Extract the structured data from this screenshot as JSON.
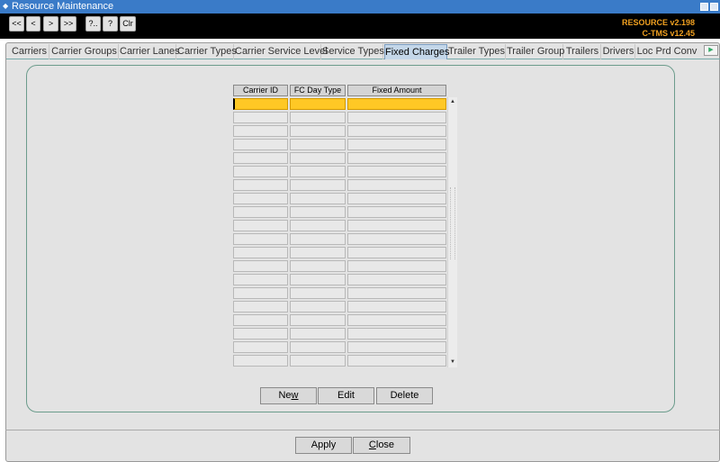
{
  "window": {
    "title": "Resource Maintenance",
    "app_icon": "java-icon",
    "min_icon": "minimize-icon",
    "max_icon": "maximize-icon"
  },
  "toolbar": {
    "first": "<<",
    "prev": "<",
    "next": ">",
    "last": ">>",
    "query": "?..",
    "execute": "?",
    "clear": "Clr"
  },
  "version": {
    "resource": "RESOURCE v2.198",
    "ctms": "C-TMS v12.45"
  },
  "tabs": [
    {
      "label": "Carriers"
    },
    {
      "label": "Carrier Groups"
    },
    {
      "label": "Carrier Lanes"
    },
    {
      "label": "Carrier Types"
    },
    {
      "label": "Carrier Service Level"
    },
    {
      "label": "Service Types"
    },
    {
      "label": "Fixed Charges",
      "active": true
    },
    {
      "label": "Trailer Types"
    },
    {
      "label": "Trailer Group"
    },
    {
      "label": "Trailers"
    },
    {
      "label": "Drivers"
    },
    {
      "label": "Loc Prd Conv"
    }
  ],
  "grid": {
    "columns": [
      "Carrier ID",
      "FC Day Type",
      "Fixed Amount"
    ],
    "row_count": 20,
    "selected_row": 0
  },
  "buttons": {
    "new": {
      "pre": "Ne",
      "ul": "w",
      "post": ""
    },
    "edit": "Edit",
    "delete": "Delete",
    "apply": "Apply",
    "close": {
      "pre": "",
      "ul": "C",
      "post": "lose"
    }
  }
}
